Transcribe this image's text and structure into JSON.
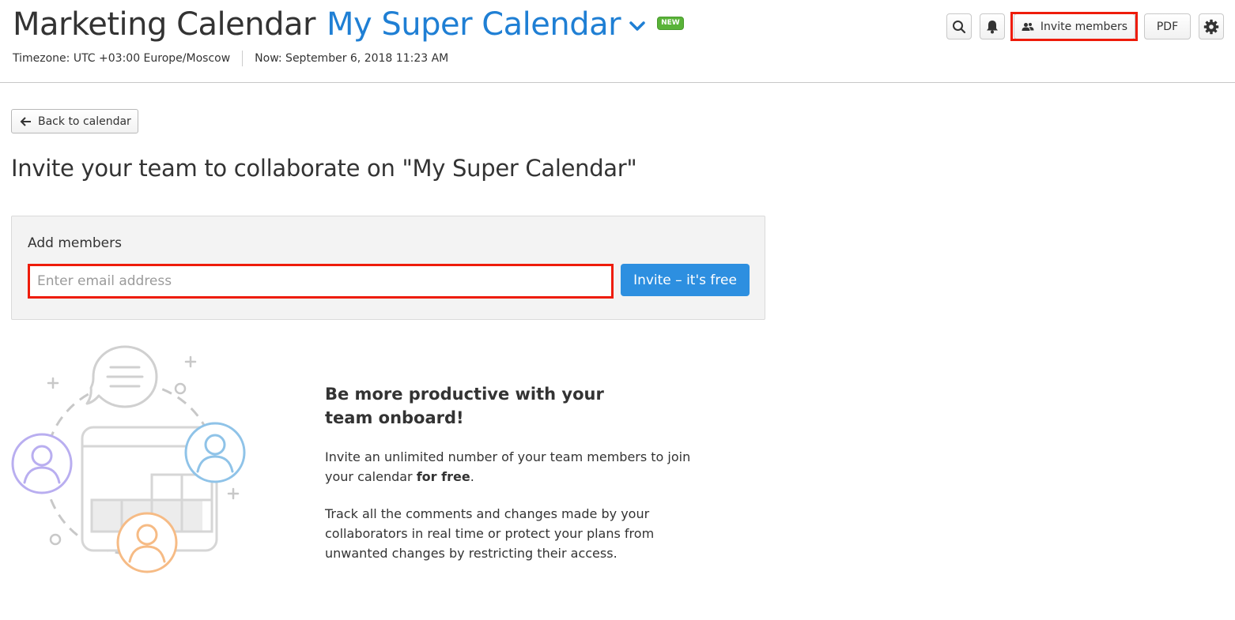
{
  "header": {
    "app_title": "Marketing Calendar",
    "calendar_name": "My Super Calendar",
    "new_badge": "NEW",
    "timezone": "Timezone: UTC +03:00 Europe/Moscow",
    "now": "Now: September 6, 2018 11:23 AM"
  },
  "toolbar": {
    "search_icon": "search-icon",
    "bell_icon": "bell-icon",
    "invite_members_label": "Invite members",
    "pdf_label": "PDF",
    "settings_icon": "gear-icon"
  },
  "back_button": {
    "label": "Back to calendar"
  },
  "page_title": "Invite your team to collaborate on \"My Super Calendar\"",
  "add_members": {
    "label": "Add members",
    "email_placeholder": "Enter email address",
    "email_value": "",
    "invite_button": "Invite – it's free"
  },
  "promo": {
    "heading": "Be more productive with your team onboard!",
    "p1_before": "Invite an unlimited number of your team members to join your calendar ",
    "p1_bold": "for free",
    "p1_after": ".",
    "p2": "Track all the comments and changes made by your collaborators in real time or protect your plans from unwanted changes by restricting their access."
  },
  "colors": {
    "accent": "#2d8fe0",
    "calendar_name": "#1f7fd4",
    "highlight": "#ee1c0a",
    "new_badge": "#59b338",
    "avatar_purple": "#b9aef0",
    "avatar_blue": "#8fc3e8",
    "avatar_orange": "#f6bb85"
  }
}
